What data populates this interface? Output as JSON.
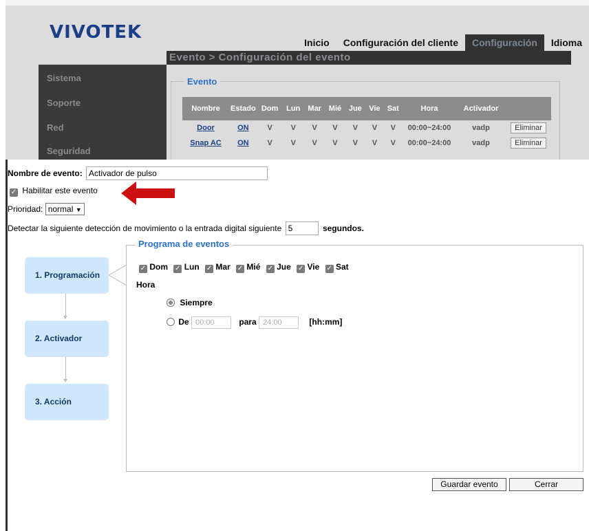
{
  "brand": {
    "logo": "VIVOTEK"
  },
  "topnav": [
    {
      "label": "Inicio",
      "active": false
    },
    {
      "label": "Configuración del cliente",
      "active": false
    },
    {
      "label": "Configuración",
      "active": true
    },
    {
      "label": "Idioma",
      "active": false
    }
  ],
  "title_bar": "Evento > Configuración del evento",
  "sidebar": [
    "Sistema",
    "Soporte",
    "Red",
    "Seguridad"
  ],
  "events_section": {
    "legend": "Evento",
    "headers": [
      "Nombre",
      "Estado",
      "Dom",
      "Lun",
      "Mar",
      "Mié",
      "Jue",
      "Vie",
      "Sat",
      "Hora",
      "Activador",
      ""
    ],
    "rows": [
      {
        "name": "Door",
        "status": "ON",
        "days": [
          "V",
          "V",
          "V",
          "V",
          "V",
          "V",
          "V"
        ],
        "time": "00:00~24:00",
        "trigger": "vadp",
        "action": "Eliminar"
      },
      {
        "name": "Snap AC",
        "status": "ON",
        "days": [
          "V",
          "V",
          "V",
          "V",
          "V",
          "V",
          "V"
        ],
        "time": "00:00~24:00",
        "trigger": "vadp",
        "action": "Eliminar"
      }
    ]
  },
  "dialog": {
    "event_name_label": "Nombre de evento:",
    "event_name_value": "Activador de pulso",
    "enable_label": "Habilitar este evento",
    "enable_checked": true,
    "priority_label": "Prioridad:",
    "priority_value": "normal",
    "detect_label": "Detectar la siguiente detección de movimiento o la entrada digital siguiente",
    "detect_value": "5",
    "detect_unit": "segundos.",
    "steps": [
      "1. Programación",
      "2. Activador",
      "3. Acción"
    ],
    "schedule": {
      "legend": "Programa de eventos",
      "days": [
        "Dom",
        "Lun",
        "Mar",
        "Mié",
        "Jue",
        "Vie",
        "Sat"
      ],
      "hora_label": "Hora",
      "always_label": "Siempre",
      "from_label": "De",
      "from_value": "00:00",
      "to_label": "para",
      "to_value": "24:00",
      "format_hint": "[hh:mm]"
    },
    "save_button": "Guardar evento",
    "close_button": "Cerrar"
  },
  "colors": {
    "accent_blue": "#2b72c8",
    "arrow_red": "#cc1010",
    "step_bg": "#cfe6fb"
  },
  "icons": {
    "arrow": "red-arrow-left-icon",
    "checkbox": "checkbox-checked-icon"
  }
}
